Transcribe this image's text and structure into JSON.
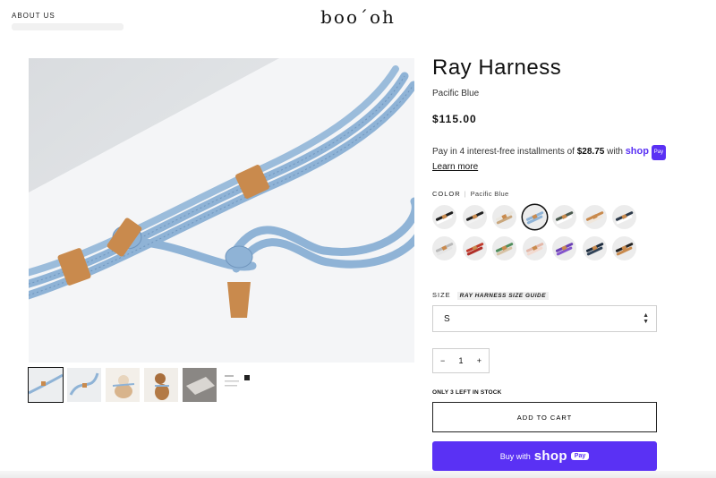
{
  "header": {
    "about_label": "ABOUT US",
    "logo": "boo´oh"
  },
  "product": {
    "title": "Ray Harness",
    "variant": "Pacific Blue",
    "price": "$115.00",
    "installments": {
      "prefix": "Pay in 4 interest-free installments of ",
      "amount": "$28.75",
      "with": " with ",
      "shop": "shop",
      "pay": "Pay",
      "learn_more": "Learn more"
    },
    "color_label": "COLOR",
    "color_value": "Pacific Blue",
    "swatches": [
      {
        "rope": "#1f1f1f",
        "rope2": "#ffffff"
      },
      {
        "rope": "#222222",
        "rope2": "#f2f2f2"
      },
      {
        "rope": "#e9e6df",
        "rope2": "#c9a77d"
      },
      {
        "rope": "#8fb3d6",
        "rope2": "#8fb3d6",
        "selected": true
      },
      {
        "rope": "#4b5a4f",
        "rope2": "#ffffff"
      },
      {
        "rope": "#c98a4d",
        "rope2": "#f0e7dc"
      },
      {
        "rope": "#2d3a4a",
        "rope2": "#ffffff"
      },
      {
        "rope": "#b9b9b9",
        "rope2": "#e5e5e5"
      },
      {
        "rope": "#c0392b",
        "rope2": "#b0302a"
      },
      {
        "rope": "#4f8d5c",
        "rope2": "#d7c3a6"
      },
      {
        "rope": "#e3b7a8",
        "rope2": "#f3d9cf"
      },
      {
        "rope": "#6b3fb3",
        "rope2": "#8455cc"
      },
      {
        "rope": "#1c2b3d",
        "rope2": "#314358"
      },
      {
        "rope": "#222222",
        "rope2": "#c98a4d"
      }
    ],
    "size_label": "SIZE",
    "size_guide": "RAY HARNESS SIZE GUIDE",
    "size_value": "S",
    "quantity": "1",
    "qty_minus": "−",
    "qty_plus": "+",
    "stock": "ONLY 3 LEFT IN STOCK",
    "add_to_cart": "ADD TO CART",
    "buy_with": "Buy with",
    "buy_shop": "shop",
    "buy_pay": "Pay"
  },
  "colors": {
    "shop_purple": "#5a31f4",
    "rope_blue": "#8fb3d6",
    "leather": "#c98a4d"
  }
}
